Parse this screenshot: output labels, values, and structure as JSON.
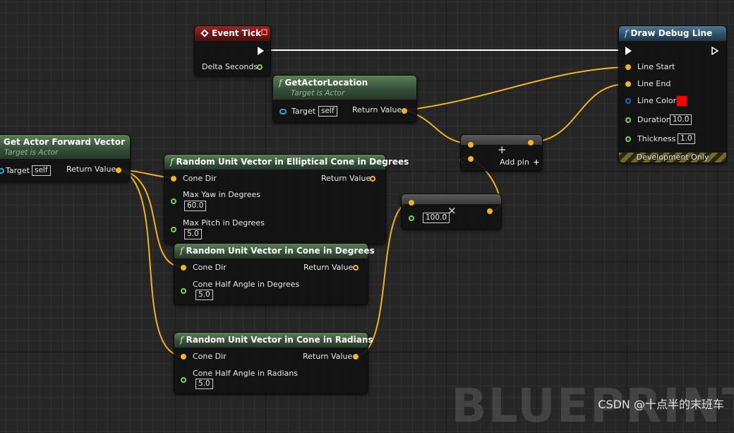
{
  "nodes": {
    "event_tick": {
      "title": "Event Tick",
      "pins": {
        "delta": "Delta Seconds"
      }
    },
    "draw_debug_line": {
      "title": "Draw Debug Line",
      "pins": {
        "line_start": "Line Start",
        "line_end": "Line End",
        "line_color": "Line Color",
        "duration": "Duration",
        "thickness": "Thickness"
      },
      "values": {
        "duration": "10.0",
        "thickness": "1.0",
        "color": "#ff0000"
      },
      "footer": "Development Only"
    },
    "get_actor_location": {
      "title": "GetActorLocation",
      "subtitle": "Target is Actor",
      "pins": {
        "target": "Target",
        "return": "Return Value"
      },
      "values": {
        "target": "self"
      }
    },
    "get_actor_forward": {
      "title": "Get Actor Forward Vector",
      "subtitle": "Target is Actor",
      "pins": {
        "target": "Target",
        "return": "Return Value"
      },
      "values": {
        "target": "self"
      }
    },
    "rand_elliptical": {
      "title": "Random Unit Vector in Elliptical Cone in Degrees",
      "pins": {
        "cone_dir": "Cone Dir",
        "return": "Return Value",
        "max_yaw": "Max Yaw in Degrees",
        "max_pitch": "Max Pitch in Degrees"
      },
      "values": {
        "max_yaw": "60.0",
        "max_pitch": "5.0"
      }
    },
    "rand_cone_deg": {
      "title": "Random Unit Vector in Cone in Degrees",
      "pins": {
        "cone_dir": "Cone Dir",
        "return": "Return Value",
        "half_angle": "Cone Half Angle in Degrees"
      },
      "values": {
        "half_angle": "5.0"
      }
    },
    "rand_cone_rad": {
      "title": "Random Unit Vector in Cone in Radians",
      "pins": {
        "cone_dir": "Cone Dir",
        "return": "Return Value",
        "half_angle": "Cone Half Angle in Radians"
      },
      "values": {
        "half_angle": "5.0"
      }
    },
    "add": {
      "symbol": "+",
      "add_pin": "Add pin",
      "add_pin_icon": "+"
    },
    "multiply": {
      "symbol": "×",
      "value": "100.0"
    }
  },
  "colors": {
    "exec": "#ffffff",
    "vector": "#f1b41c",
    "float": "#7cd65a",
    "object": "#26a6e0",
    "color": "#1e5fd8"
  },
  "watermark": {
    "big": "BLUEPRINT",
    "csdn": "CSDN @十点半的末班车"
  }
}
